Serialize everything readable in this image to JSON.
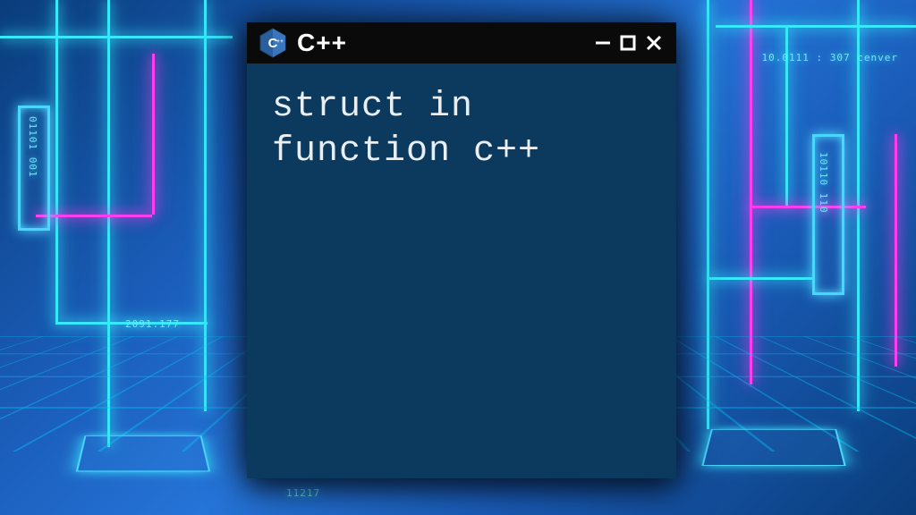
{
  "window": {
    "title": "C++",
    "body_text": "struct in function c++"
  },
  "bg_text": {
    "right_top": "10.0111 : 307  cenver",
    "left_bottom": "2091.177",
    "bottom_mid": "11217"
  },
  "colors": {
    "titlebar": "#0a0a0a",
    "terminal_body": "#0b3a5e",
    "terminal_text": "#e8eef2",
    "neon_cyan": "#38e8ff",
    "neon_magenta": "#ff3df0"
  }
}
